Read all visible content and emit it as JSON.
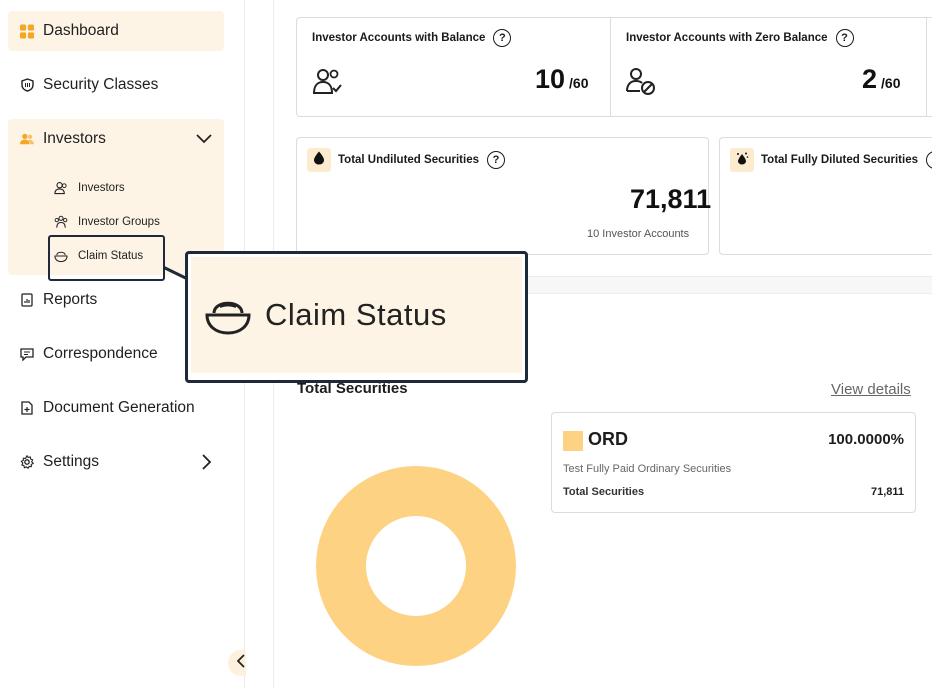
{
  "sidebar": {
    "items": [
      {
        "label": "Dashboard",
        "icon": "dashboard-grid-icon"
      },
      {
        "label": "Security Classes",
        "icon": "shield-icon"
      },
      {
        "label": "Investors",
        "icon": "users-icon"
      },
      {
        "label": "Reports",
        "icon": "report-icon"
      },
      {
        "label": "Correspondence",
        "icon": "chat-icon"
      },
      {
        "label": "Document Generation",
        "icon": "document-plus-icon"
      },
      {
        "label": "Settings",
        "icon": "gear-icon"
      }
    ],
    "investor_subitems": [
      {
        "label": "Investors",
        "icon": "user-group-icon"
      },
      {
        "label": "Investor Groups",
        "icon": "people-group-icon"
      },
      {
        "label": "Claim Status",
        "icon": "claim-bowl-icon"
      }
    ]
  },
  "cards": {
    "balance": {
      "title": "Investor Accounts with Balance",
      "value": "10",
      "denominator": "/60"
    },
    "zero_balance": {
      "title": "Investor Accounts with Zero Balance",
      "value": "2",
      "denominator": "/60"
    },
    "undiluted": {
      "title": "Total Undiluted Securities",
      "value": "71,811",
      "sub": "10 Investor Accounts"
    },
    "fully_diluted": {
      "title": "Total Fully Diluted Securities"
    }
  },
  "securities": {
    "title": "Total Securities",
    "view_details": "View details",
    "legend": {
      "code": "ORD",
      "percent": "100.0000%",
      "description": "Test Fully Paid Ordinary Securities",
      "total_label": "Total Securities",
      "total_value": "71,811"
    }
  },
  "callout": {
    "label": "Claim Status"
  },
  "colors": {
    "accent": "#fdd283",
    "highlight_bg": "#fdf4e6",
    "outline": "#1e2a3a",
    "brand_orange": "#f5a623"
  }
}
